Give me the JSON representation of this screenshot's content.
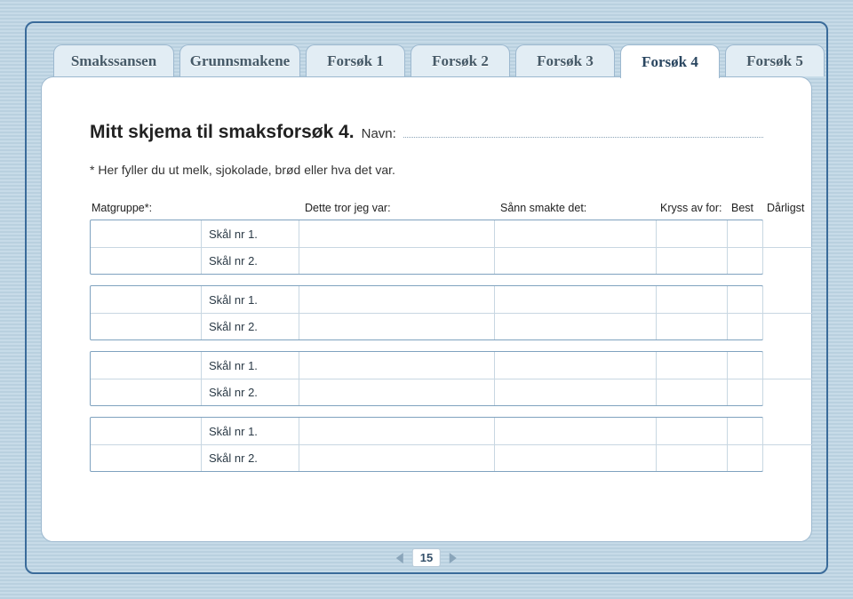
{
  "tabs": [
    {
      "label": "Smakssansen",
      "active": false,
      "wide": true
    },
    {
      "label": "Grunnsmakene",
      "active": false,
      "wide": true
    },
    {
      "label": "Forsøk 1",
      "active": false,
      "wide": false
    },
    {
      "label": "Forsøk 2",
      "active": false,
      "wide": false
    },
    {
      "label": "Forsøk 3",
      "active": false,
      "wide": false
    },
    {
      "label": "Forsøk 4",
      "active": true,
      "wide": false
    },
    {
      "label": "Forsøk 5",
      "active": false,
      "wide": false
    }
  ],
  "heading": {
    "title": "Mitt skjema til smaksforsøk 4.",
    "name_label": "Navn:",
    "name_value": ""
  },
  "note": "* Her fyller du ut melk, sjokolade, brød eller hva det var.",
  "columns": {
    "matgruppe": "Matgruppe*:",
    "skal": "",
    "dette": "Dette tror jeg var:",
    "sann": "Sånn smakte det:",
    "kryss": "Kryss av for:",
    "best": "Best",
    "darligst": "Dårligst"
  },
  "bowl_labels": {
    "r1": "Skål nr 1.",
    "r2": "Skål nr 2."
  },
  "groups": [
    {
      "matgruppe": "",
      "rows": [
        {
          "skal_key": "r1",
          "dette": "",
          "sann": "",
          "best": "",
          "darligst": ""
        },
        {
          "skal_key": "r2",
          "dette": "",
          "sann": "",
          "best": "",
          "darligst": ""
        }
      ]
    },
    {
      "matgruppe": "",
      "rows": [
        {
          "skal_key": "r1",
          "dette": "",
          "sann": "",
          "best": "",
          "darligst": ""
        },
        {
          "skal_key": "r2",
          "dette": "",
          "sann": "",
          "best": "",
          "darligst": ""
        }
      ]
    },
    {
      "matgruppe": "",
      "rows": [
        {
          "skal_key": "r1",
          "dette": "",
          "sann": "",
          "best": "",
          "darligst": ""
        },
        {
          "skal_key": "r2",
          "dette": "",
          "sann": "",
          "best": "",
          "darligst": ""
        }
      ]
    },
    {
      "matgruppe": "",
      "rows": [
        {
          "skal_key": "r1",
          "dette": "",
          "sann": "",
          "best": "",
          "darligst": ""
        },
        {
          "skal_key": "r2",
          "dette": "",
          "sann": "",
          "best": "",
          "darligst": ""
        }
      ]
    }
  ],
  "pager": {
    "page": "15"
  }
}
